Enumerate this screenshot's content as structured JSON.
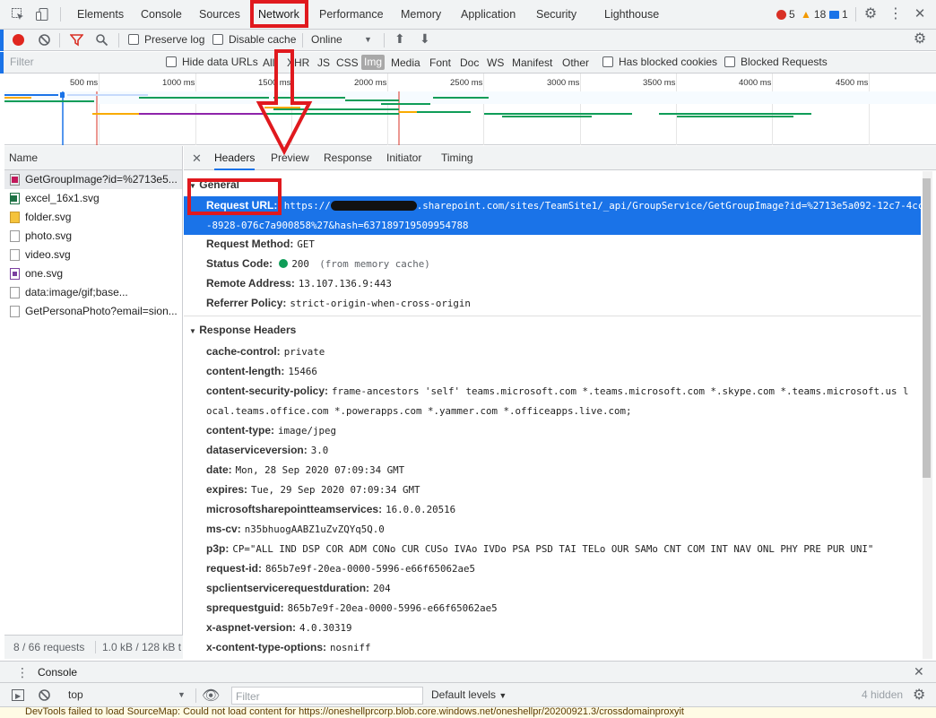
{
  "tabs": [
    {
      "label": "Elements"
    },
    {
      "label": "Console"
    },
    {
      "label": "Sources"
    },
    {
      "label": "Network"
    },
    {
      "label": "Performance"
    },
    {
      "label": "Memory"
    },
    {
      "label": "Application"
    },
    {
      "label": "Security"
    },
    {
      "label": "Lighthouse"
    }
  ],
  "badges": {
    "errors": "5",
    "warnings": "18",
    "info": "1"
  },
  "toolbar": {
    "preserve_log": "Preserve log",
    "disable_cache": "Disable cache",
    "throttle": "Online"
  },
  "filter": {
    "placeholder": "Filter",
    "hide_data_urls": "Hide data URLs",
    "types": [
      "All",
      "XHR",
      "JS",
      "CSS",
      "Img",
      "Media",
      "Font",
      "Doc",
      "WS",
      "Manifest",
      "Other"
    ],
    "selected_type": "Img",
    "has_blocked_cookies": "Has blocked cookies",
    "blocked_requests": "Blocked Requests"
  },
  "overview": {
    "ticks": [
      "500 ms",
      "1000 ms",
      "1500 ms",
      "2000 ms",
      "2500 ms",
      "3000 ms",
      "3500 ms",
      "4000 ms",
      "4500 ms"
    ]
  },
  "requests": {
    "header": "Name",
    "items": [
      {
        "name": "GetGroupImage?id=%2713e5...",
        "icon": "image-icon"
      },
      {
        "name": "excel_16x1.svg",
        "icon": "excel-icon"
      },
      {
        "name": "folder.svg",
        "icon": "folder-icon"
      },
      {
        "name": "photo.svg",
        "icon": "file-icon"
      },
      {
        "name": "video.svg",
        "icon": "file-icon"
      },
      {
        "name": "one.svg",
        "icon": "onenote-icon"
      },
      {
        "name": "data:image/gif;base...",
        "icon": "file-icon"
      },
      {
        "name": "GetPersonaPhoto?email=sion...",
        "icon": "file-icon"
      }
    ],
    "count": "8 / 66 requests",
    "size": "1.0 kB / 128 kB t"
  },
  "detail": {
    "tabs": [
      "Headers",
      "Preview",
      "Response",
      "Initiator",
      "Timing"
    ],
    "general_title": "General",
    "general": {
      "request_url_key": "Request URL:",
      "request_url_prefix": "https://",
      "request_url_rest": ".sharepoint.com/sites/TeamSite1/_api/GroupService/GetGroupImage?id=%2713e5a092-12c7-4cc1",
      "request_url_line2": "-8928-076c7a900858%27&hash=637189719509954788",
      "method_key": "Request Method:",
      "method": "GET",
      "status_key": "Status Code:",
      "status": "200",
      "status_note": "(from memory cache)",
      "remote_key": "Remote Address:",
      "remote": "13.107.136.9:443",
      "referrer_key": "Referrer Policy:",
      "referrer": "strict-origin-when-cross-origin"
    },
    "response_title": "Response Headers",
    "response_headers": [
      {
        "key": "cache-control:",
        "value": "private"
      },
      {
        "key": "content-length:",
        "value": "15466"
      },
      {
        "key": "content-security-policy:",
        "value": "frame-ancestors 'self' teams.microsoft.com *.teams.microsoft.com *.skype.com *.teams.microsoft.us l"
      },
      {
        "key": "",
        "value": "ocal.teams.office.com *.powerapps.com *.yammer.com *.officeapps.live.com;"
      },
      {
        "key": "content-type:",
        "value": "image/jpeg"
      },
      {
        "key": "dataserviceversion:",
        "value": "3.0"
      },
      {
        "key": "date:",
        "value": "Mon, 28 Sep 2020 07:09:34 GMT"
      },
      {
        "key": "expires:",
        "value": "Tue, 29 Sep 2020 07:09:34 GMT"
      },
      {
        "key": "microsoftsharepointteamservices:",
        "value": "16.0.0.20516"
      },
      {
        "key": "ms-cv:",
        "value": "n35bhuogAABZ1uZvZQYq5Q.0"
      },
      {
        "key": "p3p:",
        "value": "CP=\"ALL IND DSP COR ADM CONo CUR CUSo IVAo IVDo PSA PSD TAI TELo OUR SAMo CNT COM INT NAV ONL PHY PRE PUR UNI\""
      },
      {
        "key": "request-id:",
        "value": "865b7e9f-20ea-0000-5996-e66f65062ae5"
      },
      {
        "key": "spclientservicerequestduration:",
        "value": "204"
      },
      {
        "key": "sprequestguid:",
        "value": "865b7e9f-20ea-0000-5996-e66f65062ae5"
      },
      {
        "key": "x-aspnet-version:",
        "value": "4.0.30319"
      },
      {
        "key": "x-content-type-options:",
        "value": "nosniff"
      }
    ]
  },
  "drawer": {
    "tab": "Console",
    "context": "top",
    "filter_placeholder": "Filter",
    "levels": "Default levels",
    "hidden": "4 hidden",
    "message": "DevTools failed to load SourceMap: Could not load content for https://oneshellprcorp.blob.core.windows.net/oneshellpr/20200921.3/crossdomainproxyit"
  },
  "colors": {
    "accent": "#1a73e8",
    "annotation": "#e0191e",
    "record": "#e0261e"
  }
}
